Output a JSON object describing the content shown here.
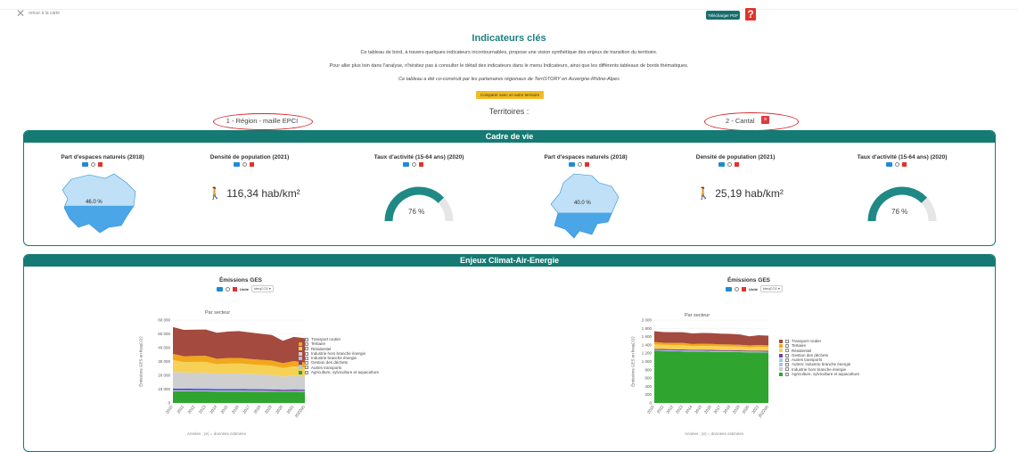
{
  "nav": {
    "back_label": "retour à la carte"
  },
  "toolbar": {
    "pdf_label": "Télécharger PDF",
    "help_label": "?"
  },
  "header": {
    "title": "Indicateurs clés",
    "intro1": "Ce tableau de bord, à travers quelques indicateurs incontournables, propose une vision synthétique des enjeux de transition du territoire.",
    "intro2": "Pour aller plus loin dans l'analyse, n'hésitez pas à consulter le détail des indicateurs dans le menu Indicateurs, ainsi que les différents tableaux de bords thématiques.",
    "intro3": "Ce tableau a été co-construit par les partenaires régionaux de TerriSTORY en Auvergne-Rhône-Alpes",
    "compare_label": "Comparer avec un autre territoire",
    "territories_label": "Territoires :"
  },
  "territories": [
    {
      "label": "1 - Région - maille EPCI"
    },
    {
      "label": "2 - Cantal",
      "remove_label": "×"
    }
  ],
  "sections": {
    "cadre": "Cadre de vie",
    "climat": "Enjeux Climat-Air-Energie"
  },
  "indicators": {
    "nat_title": "Part d'espaces naturels (2018)",
    "dens_title": "Densité de population (2021)",
    "act_title": "Taux d'activité (15-64 ans) (2020)",
    "t1": {
      "nat_value": "46.0 %",
      "nat_fraction": 0.46,
      "density_value": "116,34 hab/km²",
      "activity_value": "76 %",
      "activity_fraction": 0.76
    },
    "t2": {
      "nat_value": "40.0 %",
      "nat_fraction": 0.4,
      "density_value": "25,19 hab/km²",
      "activity_value": "76 %",
      "activity_fraction": 0.76
    }
  },
  "ges": {
    "title": "Émissions GES",
    "unit_label": "Unité",
    "unit_value": "kteqCO2",
    "subtitle": "Par secteur",
    "ylabel": "Émissions GES en kteqCO2",
    "xlabel": "Années ; (e) = données estimées",
    "years": [
      "2010",
      "2011",
      "2012",
      "2013",
      "2014",
      "2015",
      "2016",
      "2017",
      "2018",
      "2019",
      "2020",
      "2021",
      "2022(e)"
    ],
    "legend1": [
      "Transport routier",
      "Tertiaire",
      "Résidentiel",
      "Industrie hors branche énergie",
      "Industrie branche énergie",
      "Gestion des déchets",
      "Autres transports",
      "Agriculture, sylviculture et aquaculture"
    ],
    "legend2": [
      "Transport routier",
      "Tertiaire",
      "Résidentiel",
      "Gestion des déchets",
      "Autres transports",
      "Autres: industrie branche énergie",
      "Industrie hors branche énergie",
      "Agriculture, sylviculture et aquaculture"
    ]
  },
  "colors": {
    "primary": "#147a73",
    "accent": "#f2bc21",
    "danger": "#e2332b",
    "transport": "#a44a3f",
    "tertiaire": "#f2a71b",
    "residentiel": "#f7d156",
    "industrie_hors": "#cfcfcf",
    "industrie_branche": "#a9c7e6",
    "dechets": "#7b3f9e",
    "autres_transports": "#9bd0ee",
    "agriculture": "#2fa52f"
  },
  "chart_data": [
    {
      "type": "area",
      "title": "Émissions GES",
      "subtitle": "Par secteur",
      "xlabel": "Années ; (e) = données estimées",
      "ylabel": "Émissions GES en kteqCO2",
      "x": [
        "2010",
        "2011",
        "2012",
        "2013",
        "2014",
        "2015",
        "2016",
        "2017",
        "2018",
        "2019",
        "2020",
        "2021",
        "2022(e)"
      ],
      "ylim": [
        0,
        60000
      ],
      "yticks": [
        "0",
        "10 000",
        "20 000",
        "30 000",
        "40 000",
        "50 000",
        "60 000"
      ],
      "series": [
        {
          "name": "Agriculture, sylviculture et aquaculture",
          "values": [
            8500,
            8500,
            8400,
            8400,
            8300,
            8300,
            8300,
            8200,
            8200,
            8100,
            8100,
            8100,
            8000
          ]
        },
        {
          "name": "Autres transports",
          "values": [
            700,
            700,
            700,
            700,
            700,
            700,
            700,
            700,
            700,
            700,
            500,
            600,
            600
          ]
        },
        {
          "name": "Gestion des déchets",
          "values": [
            1200,
            1200,
            1150,
            1150,
            1100,
            1100,
            1100,
            1050,
            1050,
            1000,
            1000,
            1000,
            1000
          ]
        },
        {
          "name": "Industrie branche énergie",
          "values": [
            700,
            700,
            700,
            700,
            700,
            700,
            700,
            700,
            700,
            700,
            600,
            650,
            650
          ]
        },
        {
          "name": "Industrie hors branche énergie",
          "values": [
            11500,
            11000,
            11000,
            10800,
            10500,
            10500,
            10500,
            10300,
            10000,
            9800,
            8800,
            9300,
            9000
          ]
        },
        {
          "name": "Résidentiel",
          "values": [
            8500,
            7500,
            7800,
            8000,
            6800,
            7200,
            7300,
            7000,
            6800,
            6700,
            6300,
            6900,
            6500
          ]
        },
        {
          "name": "Tertiaire",
          "values": [
            4500,
            4200,
            4300,
            4400,
            3800,
            4000,
            4000,
            3900,
            3800,
            3700,
            3500,
            3800,
            3600
          ]
        },
        {
          "name": "Transport routier",
          "values": [
            19300,
            19100,
            19000,
            19000,
            18900,
            19200,
            19400,
            19200,
            18800,
            18500,
            16200,
            17500,
            17500
          ]
        }
      ]
    },
    {
      "type": "area",
      "title": "Émissions GES",
      "subtitle": "Par secteur",
      "xlabel": "Années ; (e) = données estimées",
      "ylabel": "Émissions GES en kteqCO2",
      "x": [
        "2010",
        "2011",
        "2012",
        "2013",
        "2014",
        "2015",
        "2016",
        "2017",
        "2018",
        "2019",
        "2020",
        "2021",
        "2022(e)"
      ],
      "ylim": [
        0,
        2000
      ],
      "yticks": [
        "0",
        "200",
        "400",
        "600",
        "800",
        "1 000",
        "1 200",
        "1 400",
        "1 600",
        "1 800",
        "2 000"
      ],
      "series": [
        {
          "name": "Agriculture, sylviculture et aquaculture",
          "values": [
            1260,
            1255,
            1250,
            1245,
            1240,
            1240,
            1235,
            1230,
            1230,
            1225,
            1220,
            1220,
            1215
          ]
        },
        {
          "name": "Autres: industrie branche énergie",
          "values": [
            10,
            10,
            10,
            10,
            10,
            10,
            10,
            10,
            10,
            10,
            10,
            10,
            10
          ]
        },
        {
          "name": "Autres transports",
          "values": [
            10,
            10,
            10,
            10,
            10,
            10,
            10,
            10,
            10,
            10,
            8,
            9,
            9
          ]
        },
        {
          "name": "Gestion des déchets",
          "values": [
            25,
            25,
            25,
            25,
            25,
            25,
            25,
            25,
            25,
            25,
            25,
            25,
            25
          ]
        },
        {
          "name": "Résidentiel",
          "values": [
            110,
            100,
            102,
            105,
            90,
            95,
            95,
            92,
            90,
            88,
            82,
            88,
            85
          ]
        },
        {
          "name": "Tertiaire",
          "values": [
            55,
            52,
            53,
            54,
            47,
            50,
            50,
            48,
            47,
            46,
            43,
            47,
            45
          ]
        },
        {
          "name": "Transport routier",
          "values": [
            260,
            258,
            258,
            257,
            256,
            258,
            260,
            258,
            254,
            250,
            220,
            235,
            235
          ]
        }
      ]
    }
  ]
}
